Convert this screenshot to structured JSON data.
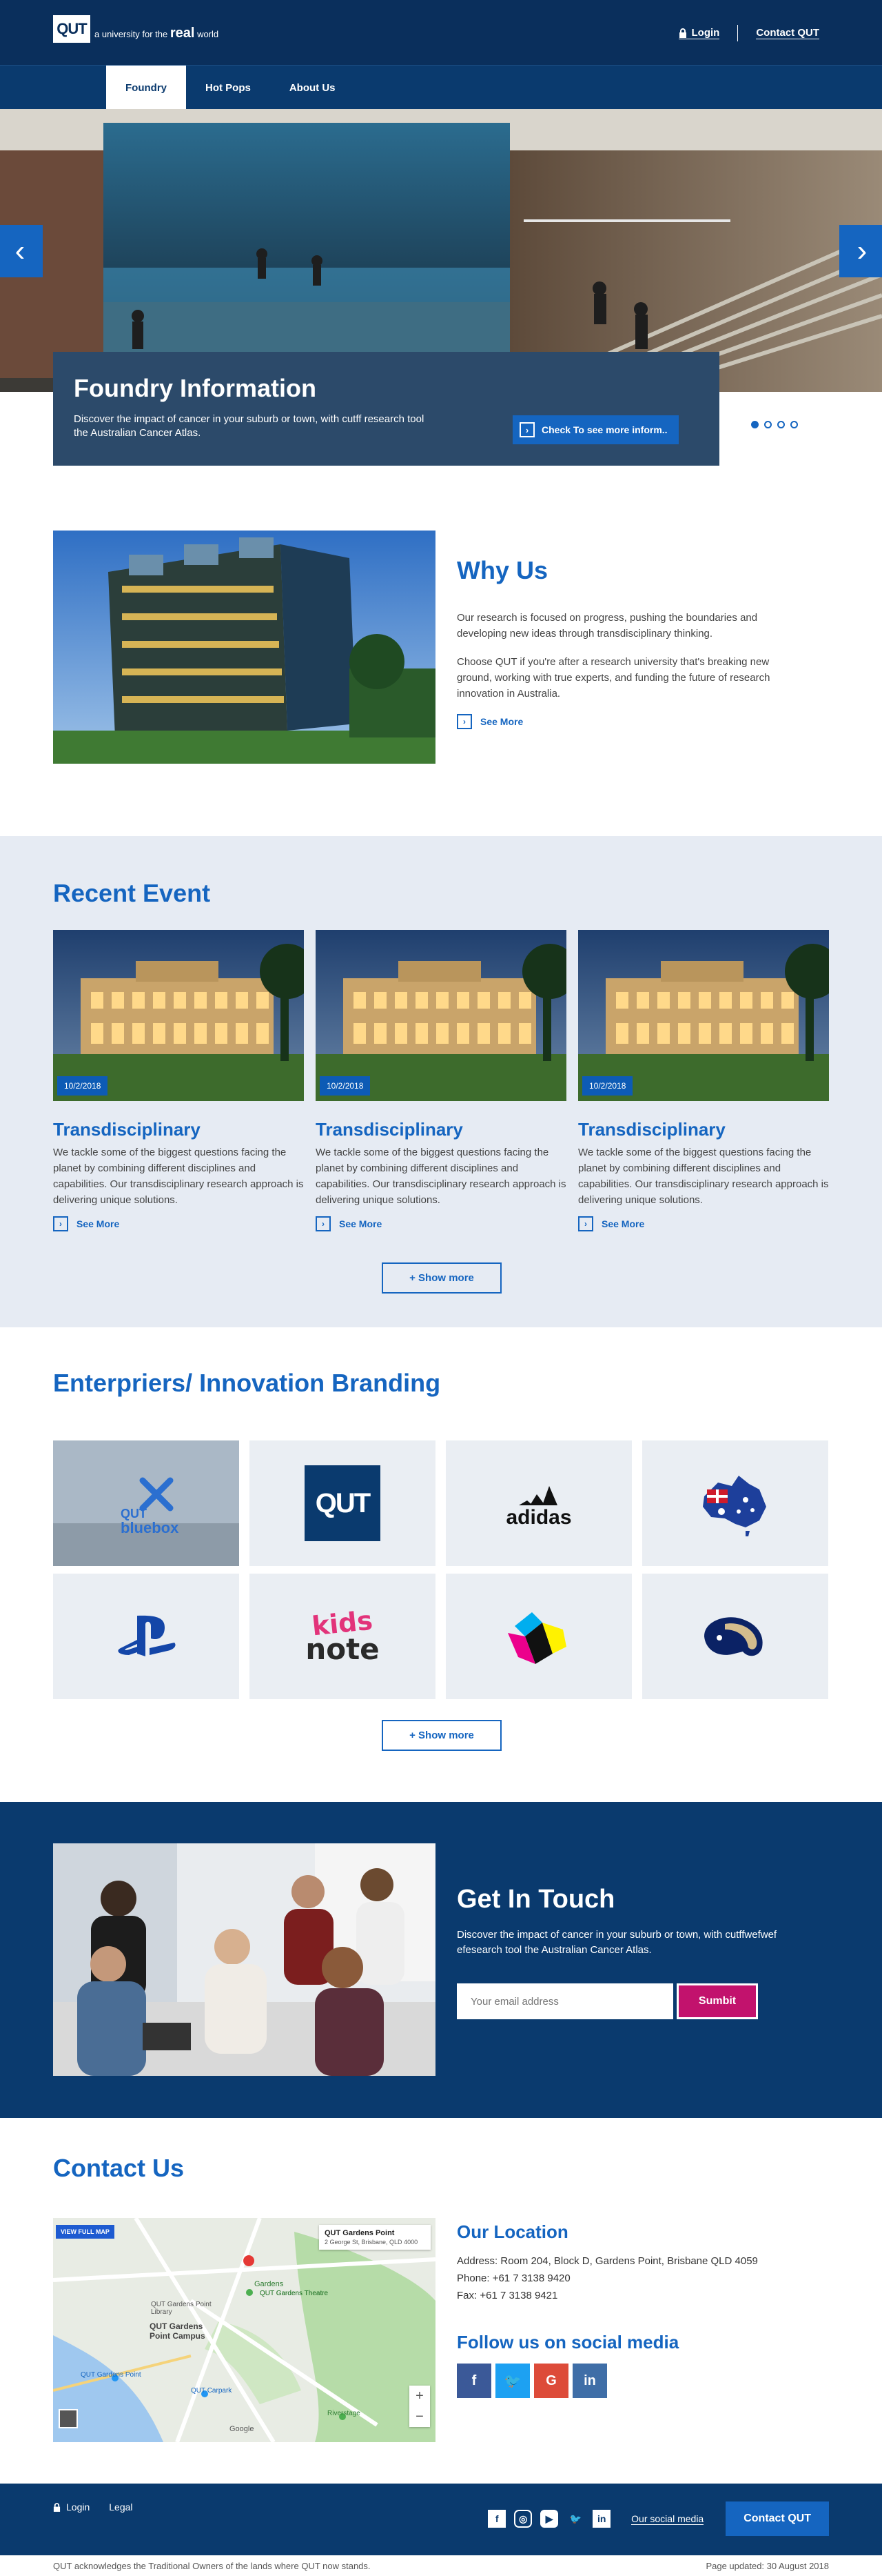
{
  "header": {
    "logo": "QUT",
    "tagline_prefix": "a university for the",
    "tagline_bold": "real",
    "tagline_suffix": "world",
    "login": "Login",
    "contact": "Contact QUT"
  },
  "nav": {
    "tabs": [
      "Foundry",
      "Hot Pops",
      "About Us"
    ],
    "active": "Foundry"
  },
  "hero": {
    "title": "Foundry Information",
    "text": "Discover the impact of cancer in your suburb or town, with cutff research tool the Australian Cancer Atlas.",
    "button": "Check To see more inform..",
    "slides": 4,
    "active_slide": 1
  },
  "why": {
    "title": "Why Us",
    "p1": "Our research is focused on progress, pushing the boundaries and developing new ideas through transdisciplinary thinking.",
    "p2": "Choose QUT if you're after a research university that's breaking new ground, working with true experts, and funding the future of research innovation in Australia.",
    "link": "See More"
  },
  "events": {
    "title": "Recent Event",
    "items": [
      {
        "date": "10/2/2018",
        "title": "Transdisciplinary",
        "text": "We tackle some of the biggest questions facing the planet by combining different disciplines and capabilities. Our transdisciplinary research approach is delivering unique solutions.",
        "link": "See More"
      },
      {
        "date": "10/2/2018",
        "title": "Transdisciplinary",
        "text": "We tackle some of the biggest questions facing the planet by combining different disciplines and capabilities. Our transdisciplinary research approach is delivering unique solutions.",
        "link": "See More"
      },
      {
        "date": "10/2/2018",
        "title": "Transdisciplinary",
        "text": "We tackle some of the biggest questions facing the planet by combining different disciplines and capabilities. Our transdisciplinary research approach is delivering unique solutions.",
        "link": "See More"
      }
    ],
    "show_more": "+ Show more"
  },
  "brand": {
    "title": "Enterpriers/ Innovation Branding",
    "logos": {
      "bluebox_top": "QUT",
      "bluebox_bottom": "bluebox",
      "qut": "QUT",
      "adidas": "adidas",
      "kids": "kids",
      "note": "note"
    },
    "show_more": "+ Show more"
  },
  "touch": {
    "title": "Get In Touch",
    "text": "Discover the impact of cancer in your suburb or town, with cutffwefwef efesearch tool the Australian Cancer Atlas.",
    "placeholder": "Your email address",
    "submit": "Sumbit"
  },
  "contact": {
    "title": "Contact Us",
    "map": {
      "full_map": "VIEW FULL MAP",
      "place": "QUT Gardens Point",
      "address": "2 George St, Brisbane, QLD 4000",
      "labels": [
        "QUT Gardens Point Library",
        "QUT Gardens Point Campus",
        "QUT Gardens Theatre",
        "QUT Carpark",
        "QUT Gardens Point",
        "Gardens",
        "Riverstage",
        "Google"
      ]
    },
    "location_title": "Our Location",
    "address": "Address: Room 204, Block D, Gardens Point, Brisbane QLD 4059",
    "phone": "Phone: +61 7 3138 9420",
    "fax": "Fax: +61 7 3138 9421",
    "follow_title": "Follow us on social media",
    "socials": [
      {
        "name": "facebook-icon",
        "glyph": "f",
        "color": "#3b5998"
      },
      {
        "name": "twitter-icon",
        "glyph": "🐦",
        "color": "#1da1f2"
      },
      {
        "name": "google-icon",
        "glyph": "G",
        "color": "#dd4b39"
      },
      {
        "name": "linkedin-icon",
        "glyph": "in",
        "color": "#3f6ea7"
      }
    ]
  },
  "footer": {
    "login": "Login",
    "legal": "Legal",
    "social_link": "Our social media",
    "contact": "Contact QUT",
    "acknowledge": "QUT acknowledges the Traditional Owners of the lands where QUT now stands.",
    "updated": "Page updated: 30 August 2018"
  },
  "colors": {
    "navy": "#0a2f5c",
    "nav": "#0a3a6e",
    "blue": "#1565c0",
    "magenta": "#c2126d",
    "event_bg": "#e6ebf3"
  }
}
